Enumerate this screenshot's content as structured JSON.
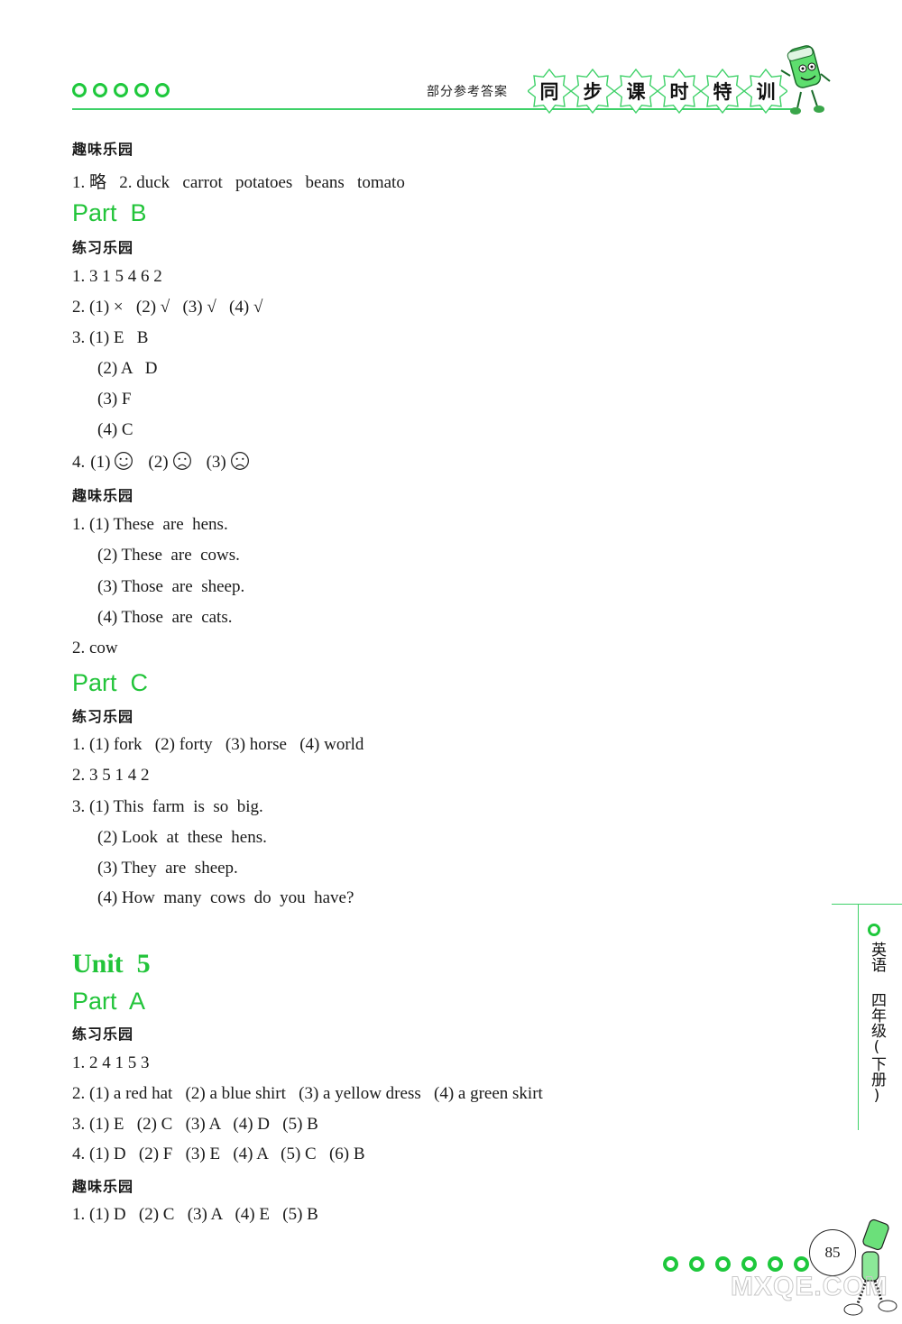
{
  "header": {
    "section_label": "部分参考答案",
    "series_title_chars": [
      "同",
      "步",
      "课",
      "时",
      "特",
      "训"
    ]
  },
  "content": [
    {
      "type": "sec",
      "text": "趣味乐园"
    },
    {
      "type": "line",
      "text": "1. 略   2. duck   carrot   potatoes   beans   tomato"
    },
    {
      "type": "part",
      "text": "Part  B"
    },
    {
      "type": "sec",
      "text": "练习乐园"
    },
    {
      "type": "line",
      "text": "1. 3 1 5 4 6 2"
    },
    {
      "type": "line",
      "text": "2. (1) ×   (2) √   (3) √   (4) √"
    },
    {
      "type": "line",
      "text": "3. (1) E   B"
    },
    {
      "type": "ind",
      "text": "(2) A   D"
    },
    {
      "type": "ind",
      "text": "(3) F"
    },
    {
      "type": "ind",
      "text": "(4) C"
    },
    {
      "type": "faces",
      "prefix": "4.",
      "items": [
        {
          "label": "(1)",
          "face": "smile"
        },
        {
          "label": "(2)",
          "face": "frown"
        },
        {
          "label": "(3)",
          "face": "frown"
        }
      ]
    },
    {
      "type": "sec",
      "text": "趣味乐园"
    },
    {
      "type": "line",
      "text": "1. (1) These  are  hens."
    },
    {
      "type": "ind",
      "text": "(2) These  are  cows."
    },
    {
      "type": "ind",
      "text": "(3) Those  are  sheep."
    },
    {
      "type": "ind",
      "text": "(4) Those  are  cats."
    },
    {
      "type": "line",
      "text": "2. cow"
    },
    {
      "type": "part",
      "text": "Part  C"
    },
    {
      "type": "sec",
      "text": "练习乐园"
    },
    {
      "type": "line",
      "text": "1. (1) fork   (2) forty   (3) horse   (4) world"
    },
    {
      "type": "line",
      "text": "2. 3 5 1 4 2"
    },
    {
      "type": "line",
      "text": "3. (1) This  farm  is  so  big."
    },
    {
      "type": "ind",
      "text": "(2) Look  at  these  hens."
    },
    {
      "type": "ind",
      "text": "(3) They  are  sheep."
    },
    {
      "type": "ind",
      "text": "(4) How  many  cows  do  you  have?"
    },
    {
      "type": "unit",
      "text": "Unit  5"
    },
    {
      "type": "part",
      "text": "Part  A"
    },
    {
      "type": "sec",
      "text": "练习乐园"
    },
    {
      "type": "line",
      "text": "1. 2 4 1 5 3"
    },
    {
      "type": "line",
      "text": "2. (1) a red hat   (2) a blue shirt   (3) a yellow dress   (4) a green skirt"
    },
    {
      "type": "line",
      "text": "3. (1) E   (2) C   (3) A   (4) D   (5) B"
    },
    {
      "type": "line",
      "text": "4. (1) D   (2) F   (3) E   (4) A   (5) C   (6) B"
    },
    {
      "type": "sec",
      "text": "趣味乐园"
    },
    {
      "type": "line",
      "text": "1. (1) D   (2) C   (3) A   (4) E   (5) B"
    }
  ],
  "side_tab": {
    "subject": "英语",
    "grade": "四年级(下册)"
  },
  "footer": {
    "page_number": "85",
    "watermark": "MXQE.COM"
  },
  "colors": {
    "accent_green": "#22c43a",
    "rule_green": "#3ed168"
  }
}
